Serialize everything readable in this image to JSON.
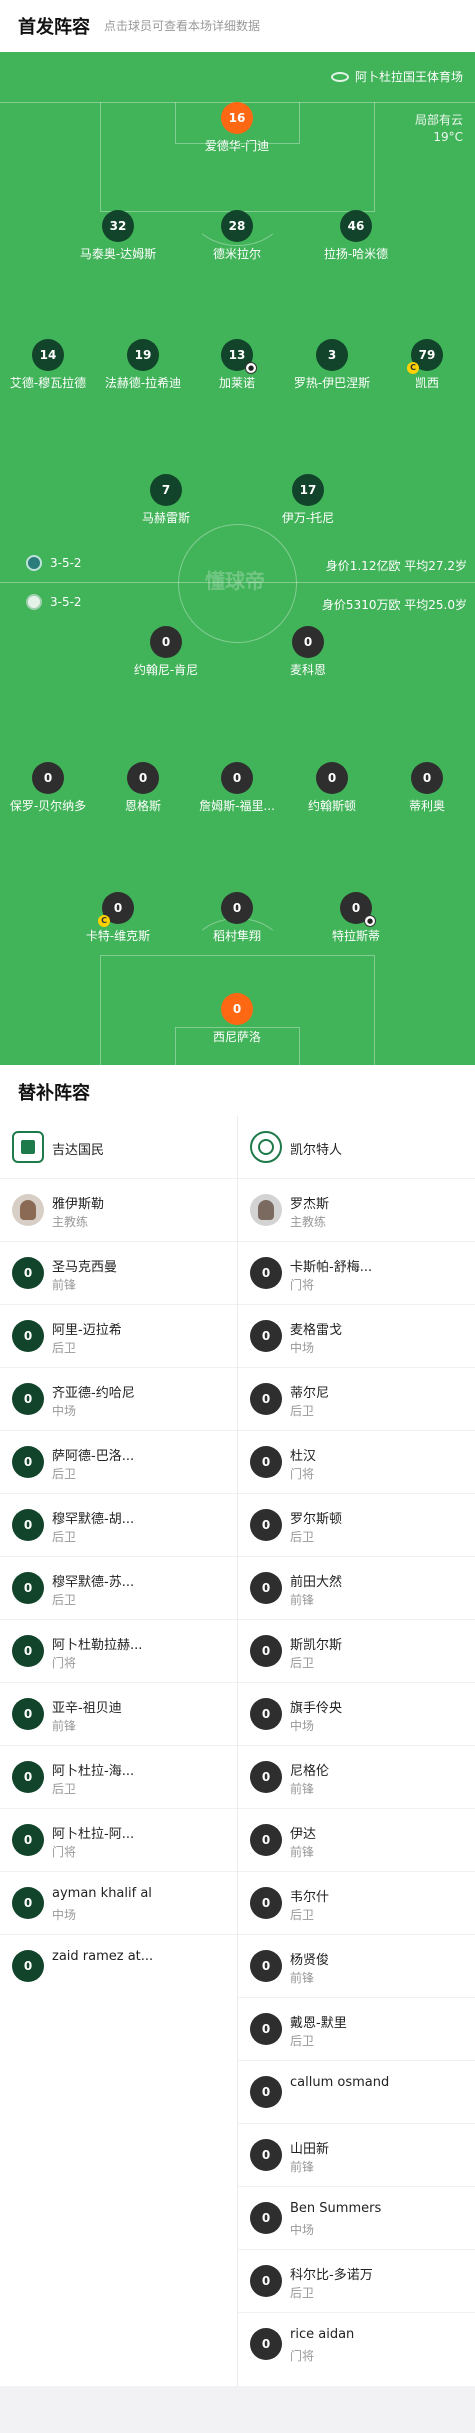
{
  "header": {
    "title": "首发阵容",
    "subtitle": "点击球员可查看本场详细数据"
  },
  "pitch": {
    "venue": "阿卜杜拉国王体育场",
    "weather": "局部有云",
    "temperature": "19°C",
    "watermark": "懂球帝",
    "away_formation": "3-5-2",
    "away_value": "身价1.12亿欧  平均27.2岁",
    "home_formation": "3-5-2",
    "home_value": "身价5310万欧  平均25.0岁"
  },
  "away_players": [
    {
      "num": "16",
      "name": "爱德华-门迪"
    },
    {
      "num": "32",
      "name": "马泰奥-达姆斯"
    },
    {
      "num": "28",
      "name": "德米拉尔"
    },
    {
      "num": "46",
      "name": "拉扬-哈米德"
    },
    {
      "num": "14",
      "name": "艾德-穆瓦拉德"
    },
    {
      "num": "19",
      "name": "法赫德-拉希迪"
    },
    {
      "num": "13",
      "name": "加莱诺"
    },
    {
      "num": "3",
      "name": "罗热-伊巴涅斯"
    },
    {
      "num": "79",
      "name": "凯西"
    },
    {
      "num": "7",
      "name": "马赫雷斯"
    },
    {
      "num": "17",
      "name": "伊万-托尼"
    }
  ],
  "home_players": [
    {
      "num": "0",
      "name": "约翰尼-肯尼"
    },
    {
      "num": "0",
      "name": "麦科恩"
    },
    {
      "num": "0",
      "name": "保罗-贝尔纳多"
    },
    {
      "num": "0",
      "name": "恩格斯"
    },
    {
      "num": "0",
      "name": "詹姆斯-福里..."
    },
    {
      "num": "0",
      "name": "约翰斯顿"
    },
    {
      "num": "0",
      "name": "蒂利奥"
    },
    {
      "num": "0",
      "name": "卡特-维克斯"
    },
    {
      "num": "0",
      "name": "稻村隼翔"
    },
    {
      "num": "0",
      "name": "特拉斯蒂"
    },
    {
      "num": "0",
      "name": "西尼萨洛"
    }
  ],
  "subs": {
    "title": "替补阵容",
    "left": {
      "team": "吉达国民",
      "coach": {
        "name": "雅伊斯勒",
        "role": "主教练"
      },
      "players": [
        {
          "num": "0",
          "name": "圣马克西曼",
          "pos": "前锋"
        },
        {
          "num": "0",
          "name": "阿里-迈拉希",
          "pos": "后卫"
        },
        {
          "num": "0",
          "name": "齐亚德-约哈尼",
          "pos": "中场"
        },
        {
          "num": "0",
          "name": "萨阿德-巴洛...",
          "pos": "后卫"
        },
        {
          "num": "0",
          "name": "穆罕默德-胡...",
          "pos": "后卫"
        },
        {
          "num": "0",
          "name": "穆罕默德-苏...",
          "pos": "后卫"
        },
        {
          "num": "0",
          "name": "阿卜杜勒拉赫...",
          "pos": "门将"
        },
        {
          "num": "0",
          "name": "亚辛-祖贝迪",
          "pos": "前锋"
        },
        {
          "num": "0",
          "name": "阿卜杜拉-海...",
          "pos": "后卫"
        },
        {
          "num": "0",
          "name": "阿卜杜拉-阿...",
          "pos": "门将"
        },
        {
          "num": "0",
          "name": "ayman khalif al",
          "pos": "中场"
        },
        {
          "num": "0",
          "name": "zaid ramez at...",
          "pos": ""
        }
      ]
    },
    "right": {
      "team": "凯尔特人",
      "coach": {
        "name": "罗杰斯",
        "role": "主教练"
      },
      "players": [
        {
          "num": "0",
          "name": "卡斯帕-舒梅...",
          "pos": "门将"
        },
        {
          "num": "0",
          "name": "麦格雷戈",
          "pos": "中场"
        },
        {
          "num": "0",
          "name": "蒂尔尼",
          "pos": "后卫"
        },
        {
          "num": "0",
          "name": "杜汉",
          "pos": "门将"
        },
        {
          "num": "0",
          "name": "罗尔斯顿",
          "pos": "后卫"
        },
        {
          "num": "0",
          "name": "前田大然",
          "pos": "前锋"
        },
        {
          "num": "0",
          "name": "斯凯尔斯",
          "pos": "后卫"
        },
        {
          "num": "0",
          "name": "旗手伶央",
          "pos": "中场"
        },
        {
          "num": "0",
          "name": "尼格伦",
          "pos": "前锋"
        },
        {
          "num": "0",
          "name": "伊达",
          "pos": "前锋"
        },
        {
          "num": "0",
          "name": "韦尔什",
          "pos": "后卫"
        },
        {
          "num": "0",
          "name": "杨贤俊",
          "pos": "前锋"
        },
        {
          "num": "0",
          "name": "戴恩-默里",
          "pos": "后卫"
        },
        {
          "num": "0",
          "name": "callum osmand",
          "pos": ""
        },
        {
          "num": "0",
          "name": "山田新",
          "pos": "前锋"
        },
        {
          "num": "0",
          "name": "Ben Summers",
          "pos": "中场"
        },
        {
          "num": "0",
          "name": "科尔比-多诺万",
          "pos": "后卫"
        },
        {
          "num": "0",
          "name": "rice aidan",
          "pos": "门将"
        }
      ]
    }
  },
  "colors": {
    "pitch": "#41b359",
    "home_dot": "#11442a",
    "away_dot": "#2e2e2e",
    "gk": "#ff6813",
    "captain": "#ffd100"
  }
}
